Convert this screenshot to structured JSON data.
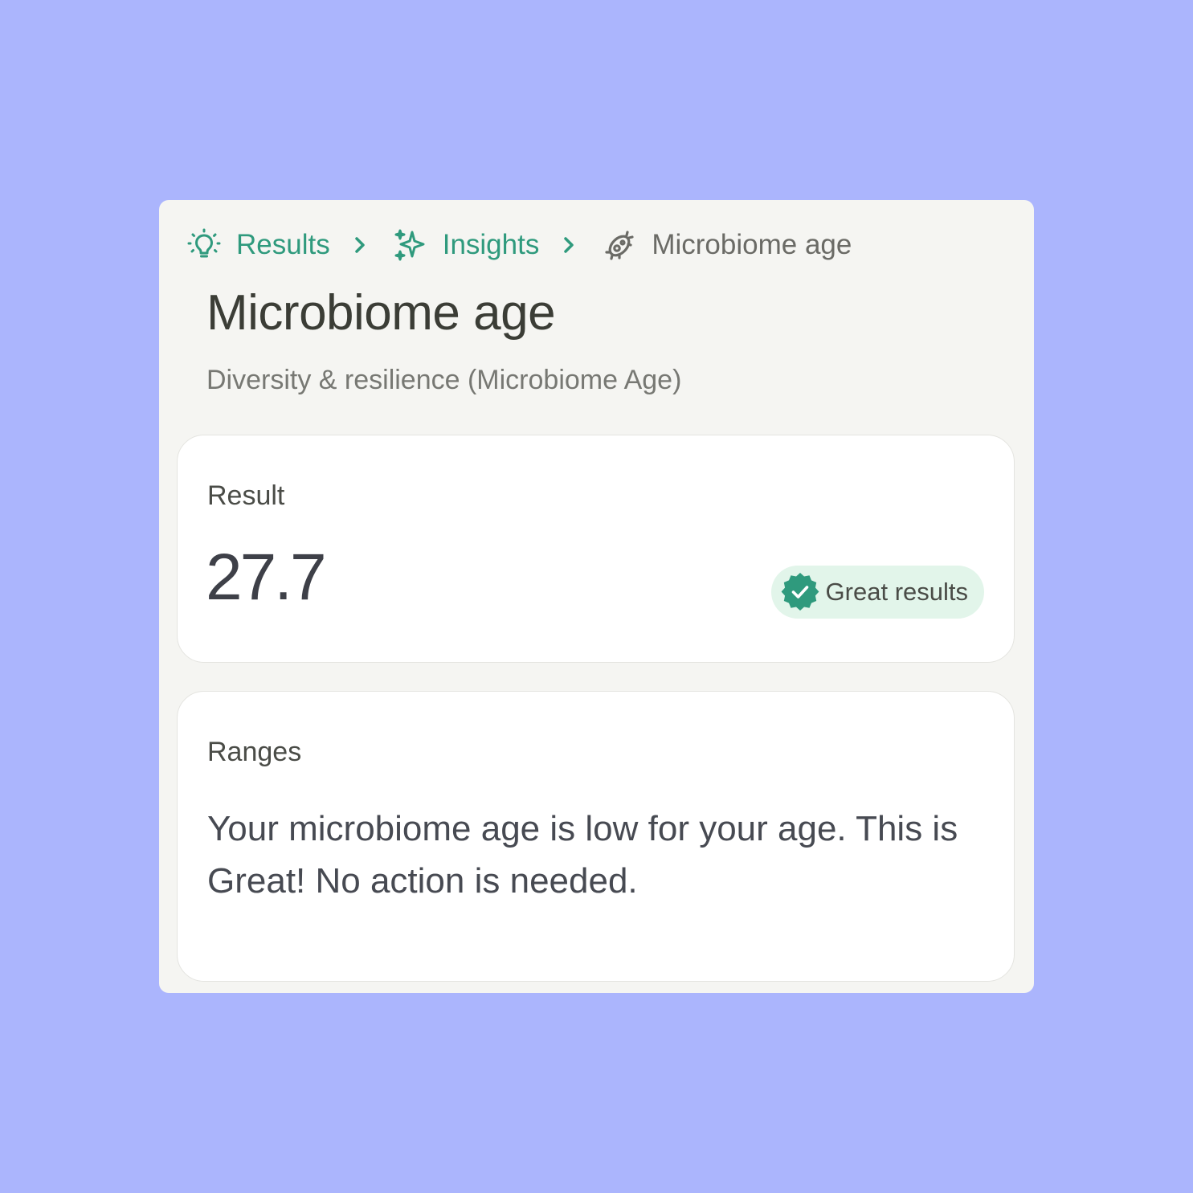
{
  "breadcrumb": {
    "items": [
      {
        "label": "Results",
        "icon": "lightbulb-icon"
      },
      {
        "label": "Insights",
        "icon": "sparkles-icon"
      },
      {
        "label": "Microbiome age",
        "icon": "bacteria-icon"
      }
    ],
    "separator_icon": "chevron-right-icon"
  },
  "page": {
    "title": "Microbiome age",
    "subtitle": "Diversity & resilience (Microbiome Age)"
  },
  "result_card": {
    "label": "Result",
    "value": "27.7",
    "badge": {
      "label": "Great results",
      "icon": "check-badge-icon"
    }
  },
  "ranges_card": {
    "label": "Ranges",
    "text": "Your microbiome age is low for your age. This is Great! No action is needed."
  },
  "colors": {
    "background": "#abb5fd",
    "panel": "#f5f5f2",
    "accent": "#2f9a7d",
    "badge_bg": "#e2f5ea",
    "text_dark": "#3b3d36",
    "text_muted": "#777873"
  }
}
